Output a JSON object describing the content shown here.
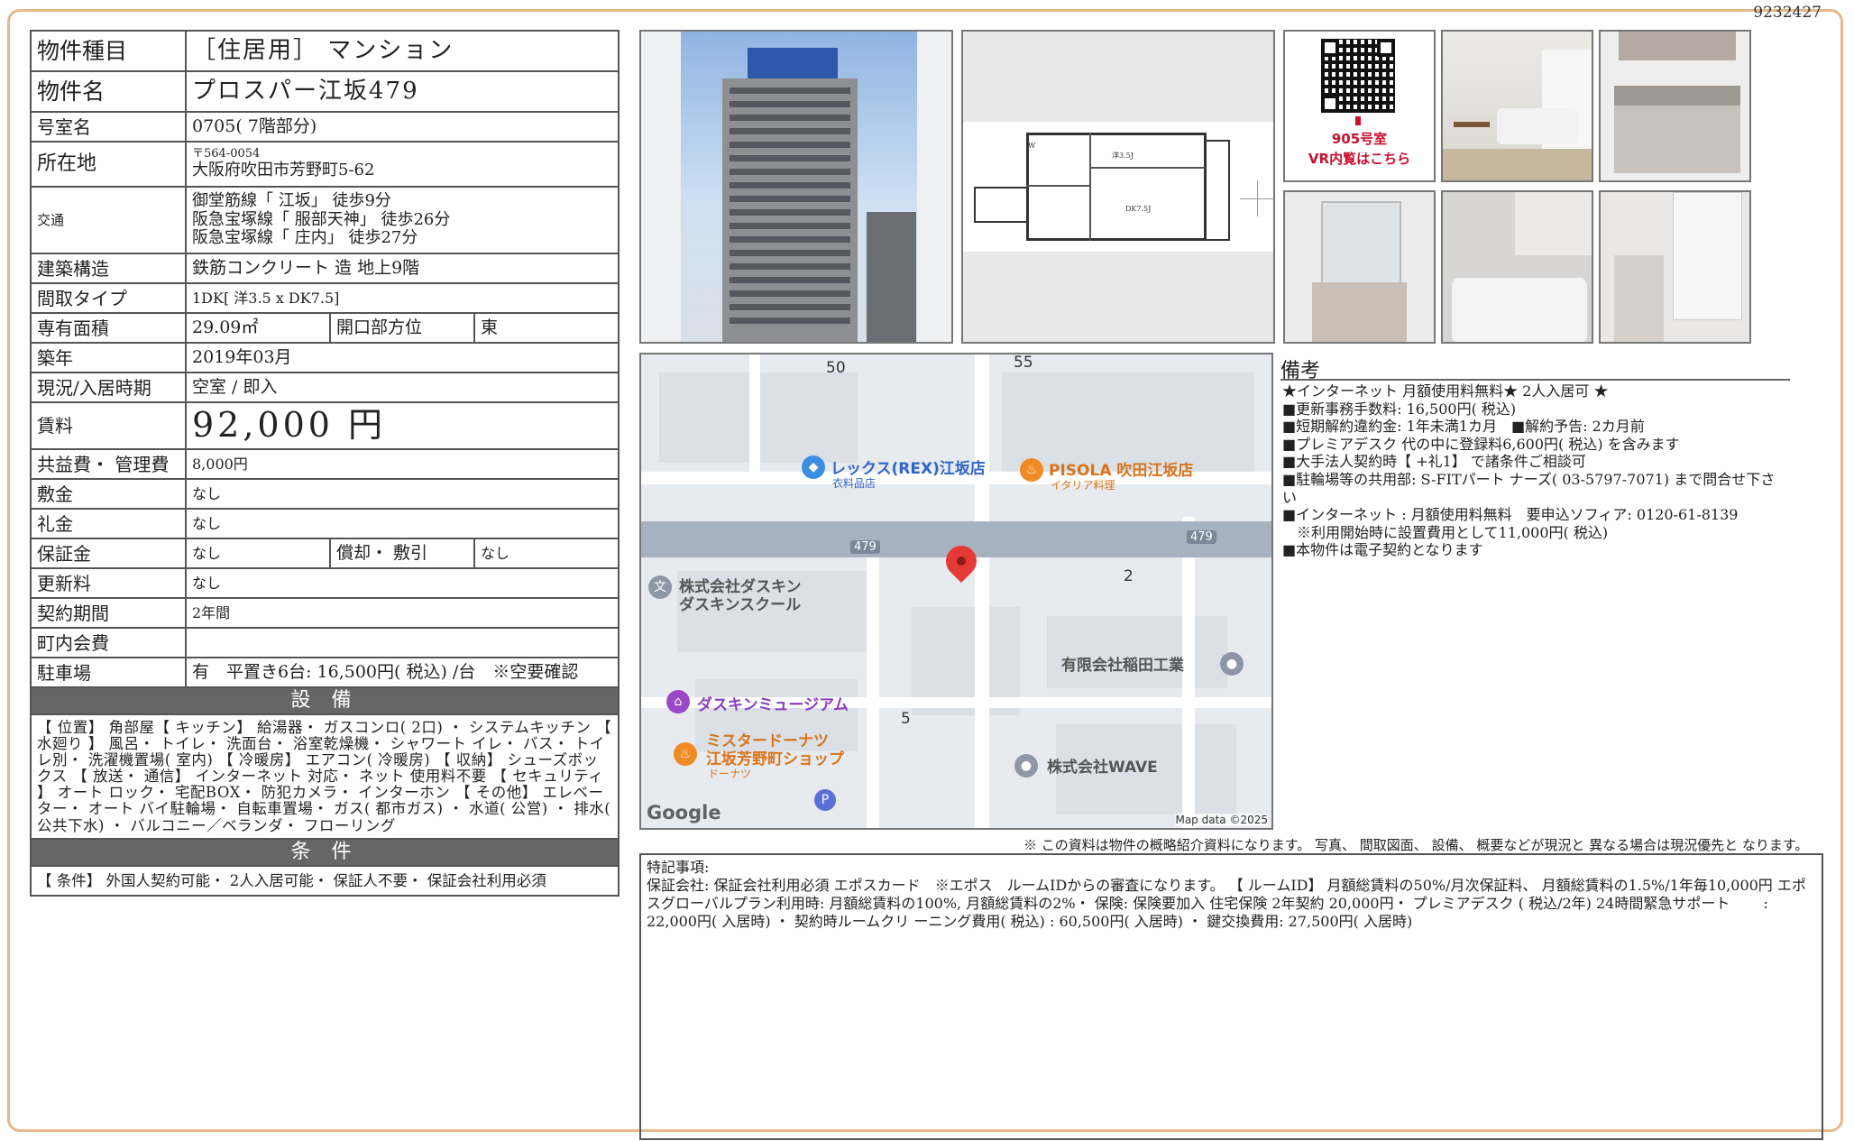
{
  "doc_id": "9232427",
  "property": {
    "type_label": "物件種目",
    "type_value": "［住居用］ マンション",
    "name_label": "物件名",
    "name_value": "プロスパー江坂479",
    "room_label": "号室名",
    "room_value": "0705( 7階部分)",
    "address_label": "所在地",
    "zip": "〒564-0054",
    "address": "大阪府吹田市芳野町5-62",
    "transport_label": "交通",
    "transport": [
      "御堂筋線「 江坂」 徒歩9分",
      "阪急宝塚線「 服部天神」 徒歩26分",
      "阪急宝塚線「 庄内」 徒歩27分"
    ],
    "structure_label": "建築構造",
    "structure_value": "鉄筋コンクリート 造 地上9階",
    "layout_label": "間取タイプ",
    "layout_value": "1DK[ 洋3.5 x DK7.5]",
    "area_label": "専有面積",
    "area_value": "29.09㎡",
    "orientation_label": "開口部方位",
    "orientation_value": "東",
    "built_label": "築年",
    "built_value": "2019年03月",
    "status_label": "現況/入居時期",
    "status_value": "空室 / 即入",
    "rent_label": "賃料",
    "rent_value": "92,000 円",
    "fee_label": "共益費・ 管理費",
    "fee_value": "8,000円",
    "deposit_label": "敷金",
    "deposit_value": "なし",
    "key_money_label": "礼金",
    "key_money_value": "なし",
    "guarantee_label": "保証金",
    "guarantee_value": "なし",
    "amort_label": "償却・ 敷引",
    "amort_value": "なし",
    "renewal_label": "更新料",
    "renewal_value": "なし",
    "contract_label": "契約期間",
    "contract_value": "2年間",
    "community_label": "町内会費",
    "community_value": "",
    "parking_label": "駐車場",
    "parking_value": "有　平置き6台: 16,500円( 税込) /台　※空要確認"
  },
  "equipment": {
    "heading": "設 備",
    "text": "【 位置】 角部屋【 キッチン】 給湯器・ ガスコンロ( 2口) ・ システムキッチン 【 水廻り 】 風呂・ トイレ・ 洗面台・ 浴室乾燥機・ シャワート イレ・ バス・ トイレ別・ 洗濯機置場( 室内) 【 冷暖房】 エアコン( 冷暖房) 【 収納】 シューズボックス 【 放送・ 通信】 インターネット 対応・ ネット 使用料不要 【 セキュリティ 】 オート ロック・ 宅配BOX・ 防犯カメラ・ インターホン 【 その他】 エレベーター・ オート バイ駐輪場・ 自転車置場・ ガス( 都市ガス) ・ 水道( 公営) ・ 排水( 公共下水) ・ バルコニー／ベランダ・ フローリング"
  },
  "conditions": {
    "heading": "条 件",
    "text": "【 条件】 外国人契約可能・ 2人入居可能・ 保証人不要・ 保証会社利用必須"
  },
  "photos": {
    "qr_room": "905号室",
    "qr_caption": "VR内覧はこちら"
  },
  "map": {
    "poi": [
      {
        "name": "レックス(REX)江坂店",
        "sub": "衣料品店"
      },
      {
        "name": "PISOLA 吹田江坂店",
        "sub": "イタリア料理"
      },
      {
        "name": "株式会社ダスキン",
        "sub": "ダスキンスクール"
      },
      {
        "name": "有限会社稲田工業",
        "sub": ""
      },
      {
        "name": "ダスキンミュージアム",
        "sub": ""
      },
      {
        "name": "ミスタードーナツ",
        "sub": "江坂芳野町ショップ"
      },
      {
        "name": "ドーナツ",
        "sub": ""
      },
      {
        "name": "株式会社WAVE",
        "sub": ""
      }
    ],
    "road_numbers": [
      "479",
      "479"
    ],
    "block_numbers": [
      "50",
      "55",
      "2",
      "5"
    ],
    "logo": "Google",
    "attribution": "Map data ©2025",
    "parking_symbol": "P"
  },
  "notes": {
    "title": "備考",
    "lines": [
      "★インターネット 月額使用料無料★ 2人入居可 ★",
      "■更新事務手数料: 16,500円( 税込)",
      "■短期解約違約金: 1年未満1カ月　■解約予告: 2カ月前",
      "■プレミアデスク 代の中に登録料6,600円( 税込) を含みます",
      "■大手法人契約時【 +礼1】 で諸条件ご相談可",
      "■駐輪場等の共用部: S-FITパート ナーズ( 03-5797-7071) まで問合せ下さい",
      "■インターネット : 月額使用料無料　要申込ソフィア: 0120-61-8139",
      "　※利用開始時に設置費用として11,000円( 税込)",
      "■本物件は電子契約となります"
    ]
  },
  "disclaimer": "※ この資料は物件の概略紹介資料になります。 写真、 間取図面、 設備、 概要などが現況と 異なる場合は現況優先と なります。",
  "special": {
    "title": "特記事項:",
    "text": "保証会社: 保証会社利用必須 エポスカード　※エポス　ルームIDからの審査になります。 【 ルームID】 月額総賃料の50%/月次保証料、 月額総賃料の1.5%/1年毎10,000円 エポスグローバルプラン利用時: 月額総賃料の100%, 月額総賃料の2%・ 保険: 保険要加入 住宅保険 2年契約 20,000円・ プレミアデスク ( 税込/2年) 24時間緊急サポート 　　: 22,000円( 入居時) ・ 契約時ルームクリ ーニング費用( 税込) : 60,500円( 入居時) ・ 鍵交換費用: 27,500円( 入居時)"
  }
}
